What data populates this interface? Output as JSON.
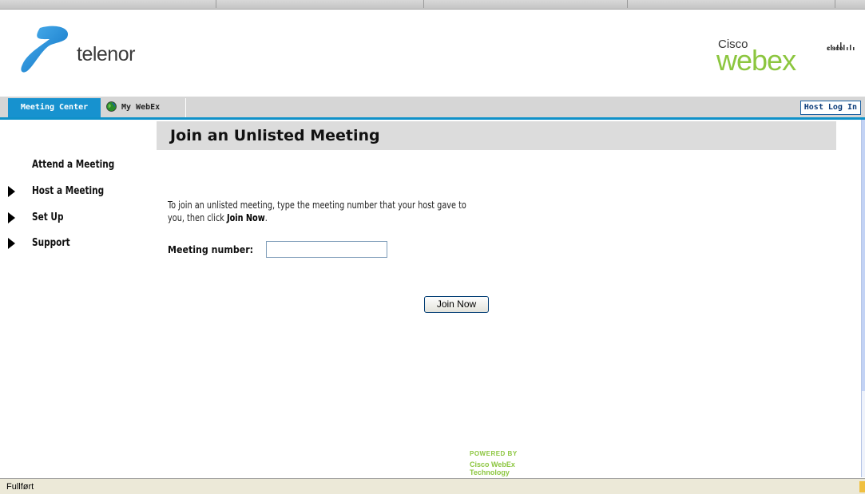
{
  "header": {
    "brand_name": "telenor",
    "partner_cisco": "Cisco",
    "partner_webex": "webex",
    "cisco_mark": "cisco"
  },
  "nav": {
    "tab_meeting_center": "Meeting Center",
    "tab_my_webex": "My WebEx",
    "host_login": "Host Log In"
  },
  "sidebar": {
    "items": [
      {
        "label": "Attend a Meeting",
        "has_arrow": false
      },
      {
        "label": "Host a Meeting",
        "has_arrow": true
      },
      {
        "label": "Set Up",
        "has_arrow": true
      },
      {
        "label": "Support",
        "has_arrow": true
      }
    ]
  },
  "main": {
    "title": "Join an Unlisted Meeting",
    "instructions_part1": "To join an unlisted meeting, type the meeting number that your host gave to you, then click ",
    "instructions_bold": "Join Now",
    "instructions_part2": ".",
    "meeting_number_label": "Meeting number:",
    "meeting_number_value": "",
    "join_button": "Join Now"
  },
  "footer": {
    "powered_by": "POWERED BY",
    "powered_by_sub": "Cisco WebEx Technology"
  },
  "status": {
    "text": "Fullført"
  },
  "colors": {
    "tab_blue": "#1792cf",
    "webex_green": "#8cc63f",
    "nav_gray": "#d6d6d6",
    "title_bar_gray": "#dcdcdc"
  }
}
